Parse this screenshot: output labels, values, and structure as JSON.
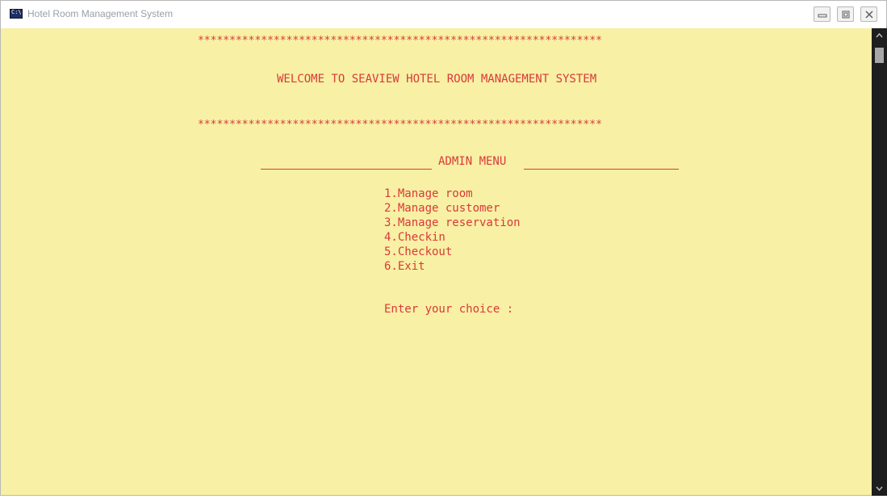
{
  "window": {
    "title": "Hotel Room Management System",
    "icon": "console-app-icon"
  },
  "controls": {
    "minimize_icon": "minimize-icon",
    "maximize_icon": "maximize-icon",
    "close_icon": "close-icon"
  },
  "console": {
    "stars_top": "****************************************************************",
    "welcome": "WELCOME TO SEAVIEW HOTEL ROOM MANAGEMENT SYSTEM",
    "stars_bottom": "****************************************************************",
    "admin_menu_title": "ADMIN MENU",
    "menu_items": [
      {
        "label": "1.Manage room"
      },
      {
        "label": "2.Manage customer"
      },
      {
        "label": "3.Manage reservation"
      },
      {
        "label": "4.Checkin"
      },
      {
        "label": "5.Checkout"
      },
      {
        "label": "6.Exit"
      }
    ],
    "prompt": "Enter your choice :"
  },
  "colors": {
    "console_background": "#f8f0a4",
    "console_text": "#d83a3a",
    "scrollbar": "#1e1e1e"
  }
}
